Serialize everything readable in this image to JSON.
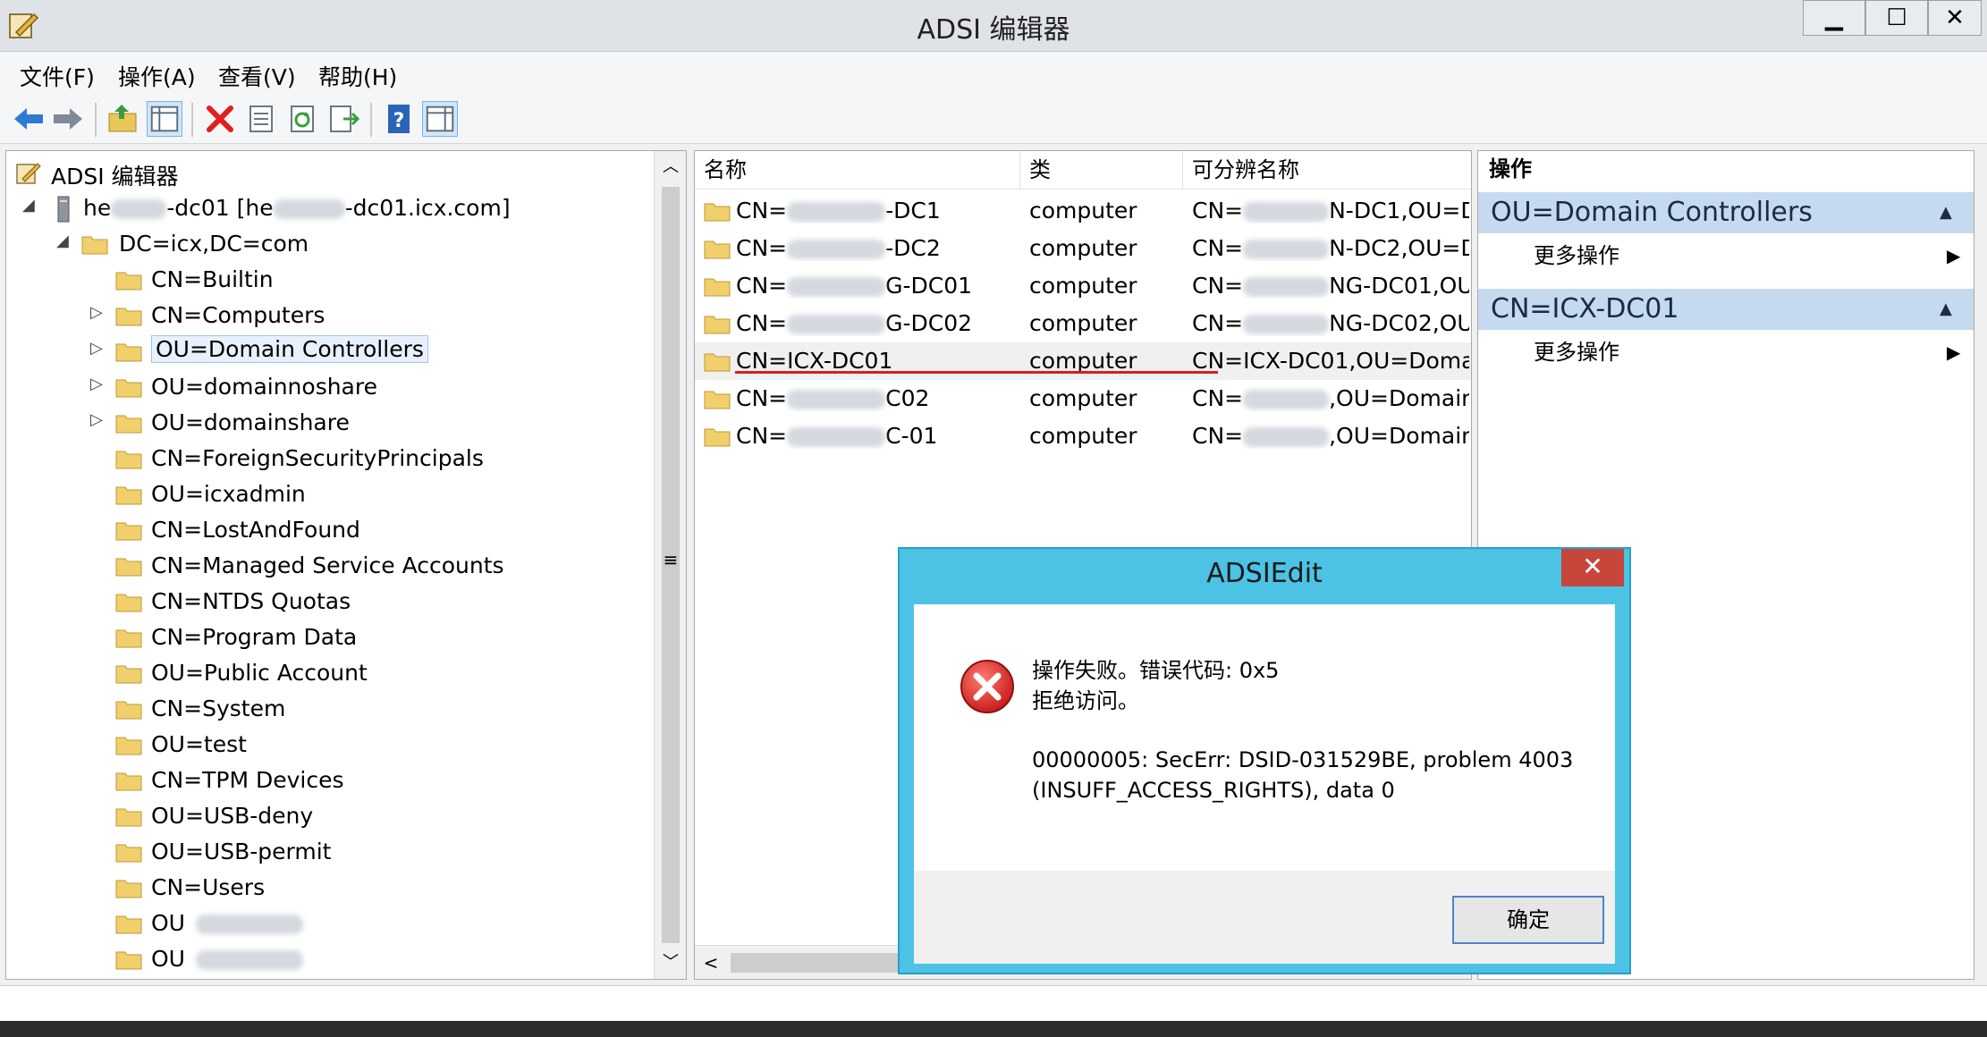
{
  "window": {
    "title": "ADSI 编辑器",
    "controls": {
      "minimize": "▁",
      "maximize": "☐",
      "close": "✕"
    }
  },
  "menu": [
    "文件(F)",
    "操作(A)",
    "查看(V)",
    "帮助(H)"
  ],
  "toolbar_icons": [
    "back-arrow-icon",
    "forward-arrow-icon",
    "up-folder-icon",
    "show-tree-icon",
    "delete-icon",
    "properties-icon",
    "refresh-icon",
    "export-list-icon",
    "help-icon",
    "show-action-pane-icon"
  ],
  "tree": {
    "root": "ADSI 编辑器",
    "server": {
      "prefix": "he",
      "mid": "-dc01 [he",
      "suffix": "-dc01.icx.com]"
    },
    "domain": "DC=icx,DC=com",
    "items": [
      {
        "label": "CN=Builtin",
        "expandable": false
      },
      {
        "label": "CN=Computers",
        "expandable": true
      },
      {
        "label": "OU=Domain Controllers",
        "expandable": true,
        "selected": true
      },
      {
        "label": "OU=domainnoshare",
        "expandable": true
      },
      {
        "label": "OU=domainshare",
        "expandable": true
      },
      {
        "label": "CN=ForeignSecurityPrincipals",
        "expandable": false
      },
      {
        "label": "OU=icxadmin",
        "expandable": false
      },
      {
        "label": "CN=LostAndFound",
        "expandable": false
      },
      {
        "label": "CN=Managed Service Accounts",
        "expandable": false
      },
      {
        "label": "CN=NTDS Quotas",
        "expandable": false
      },
      {
        "label": "CN=Program Data",
        "expandable": false
      },
      {
        "label": "OU=Public Account",
        "expandable": false
      },
      {
        "label": "CN=System",
        "expandable": false
      },
      {
        "label": "OU=test",
        "expandable": false
      },
      {
        "label": "CN=TPM Devices",
        "expandable": false
      },
      {
        "label": "OU=USB-deny",
        "expandable": false
      },
      {
        "label": "OU=USB-permit",
        "expandable": false
      },
      {
        "label": "CN=Users",
        "expandable": false
      },
      {
        "label": "OU",
        "expandable": false,
        "blurred": true
      },
      {
        "label": "OU",
        "expandable": false,
        "blurred": true
      }
    ]
  },
  "list": {
    "columns": [
      "名称",
      "类",
      "可分辨名称"
    ],
    "rows": [
      {
        "name_pre": "CN=",
        "name_post": "-DC1",
        "cls": "computer",
        "dn_pre": "CN=",
        "dn_post": "N-DC1,OU=D"
      },
      {
        "name_pre": "CN=",
        "name_post": "-DC2",
        "cls": "computer",
        "dn_pre": "CN=",
        "dn_post": "N-DC2,OU=D"
      },
      {
        "name_pre": "CN=",
        "name_post": "G-DC01",
        "cls": "computer",
        "dn_pre": "CN=",
        "dn_post": "NG-DC01,OU"
      },
      {
        "name_pre": "CN=",
        "name_post": "G-DC02",
        "cls": "computer",
        "dn_pre": "CN=",
        "dn_post": "NG-DC02,OU"
      },
      {
        "name_pre": "CN=ICX-DC01",
        "name_post": "",
        "cls": "computer",
        "dn_pre": "CN=ICX-DC01,OU=Domain",
        "dn_post": "",
        "highlight": true
      },
      {
        "name_pre": "CN=",
        "name_post": "C02",
        "cls": "computer",
        "dn_pre": "CN=",
        "dn_post": ",OU=Domain"
      },
      {
        "name_pre": "CN=",
        "name_post": "C-01",
        "cls": "computer",
        "dn_pre": "CN=",
        "dn_post": ",OU=Domain"
      }
    ]
  },
  "actions": {
    "header": "操作",
    "sections": [
      {
        "title": "OU=Domain Controllers",
        "item": "更多操作"
      },
      {
        "title": "CN=ICX-DC01",
        "item": "更多操作"
      }
    ]
  },
  "dialog": {
    "title": "ADSIEdit",
    "close": "✕",
    "line1": "操作失败。错误代码: 0x5",
    "line2": "拒绝访问。",
    "line3": "00000005: SecErr: DSID-031529BE, problem 4003",
    "line4": "(INSUFF_ACCESS_RIGHTS), data 0",
    "ok": "确定"
  },
  "colors": {
    "accent": "#4cc2e4",
    "error": "#d9302c",
    "section_bg": "#c5d9ef",
    "underline": "#d81e1e"
  }
}
